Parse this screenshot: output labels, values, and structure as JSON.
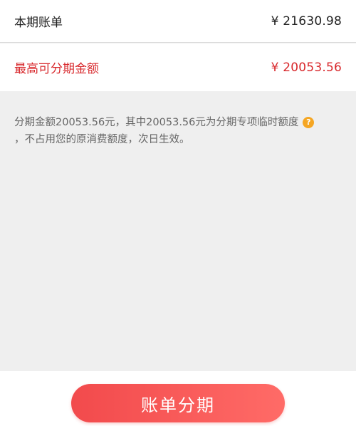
{
  "bill": {
    "label": "本期账单",
    "amount": "¥ 21630.98"
  },
  "max_installment": {
    "label": "最高可分期金额",
    "amount": "¥ 20053.56"
  },
  "note": {
    "line1": "分期金额20053.56元，其中20053.56元为分期专项临时额度",
    "line2": "，不占用您的原消费额度，次日生效。",
    "help_icon": "question-mark-icon",
    "help_glyph": "?"
  },
  "footer": {
    "button_label": "账单分期"
  },
  "colors": {
    "accent_red": "#d8282c",
    "button_gradient_start": "#f24a4c",
    "button_gradient_end": "#ff6b67",
    "help_icon": "#f5a623",
    "background": "#efefef"
  }
}
